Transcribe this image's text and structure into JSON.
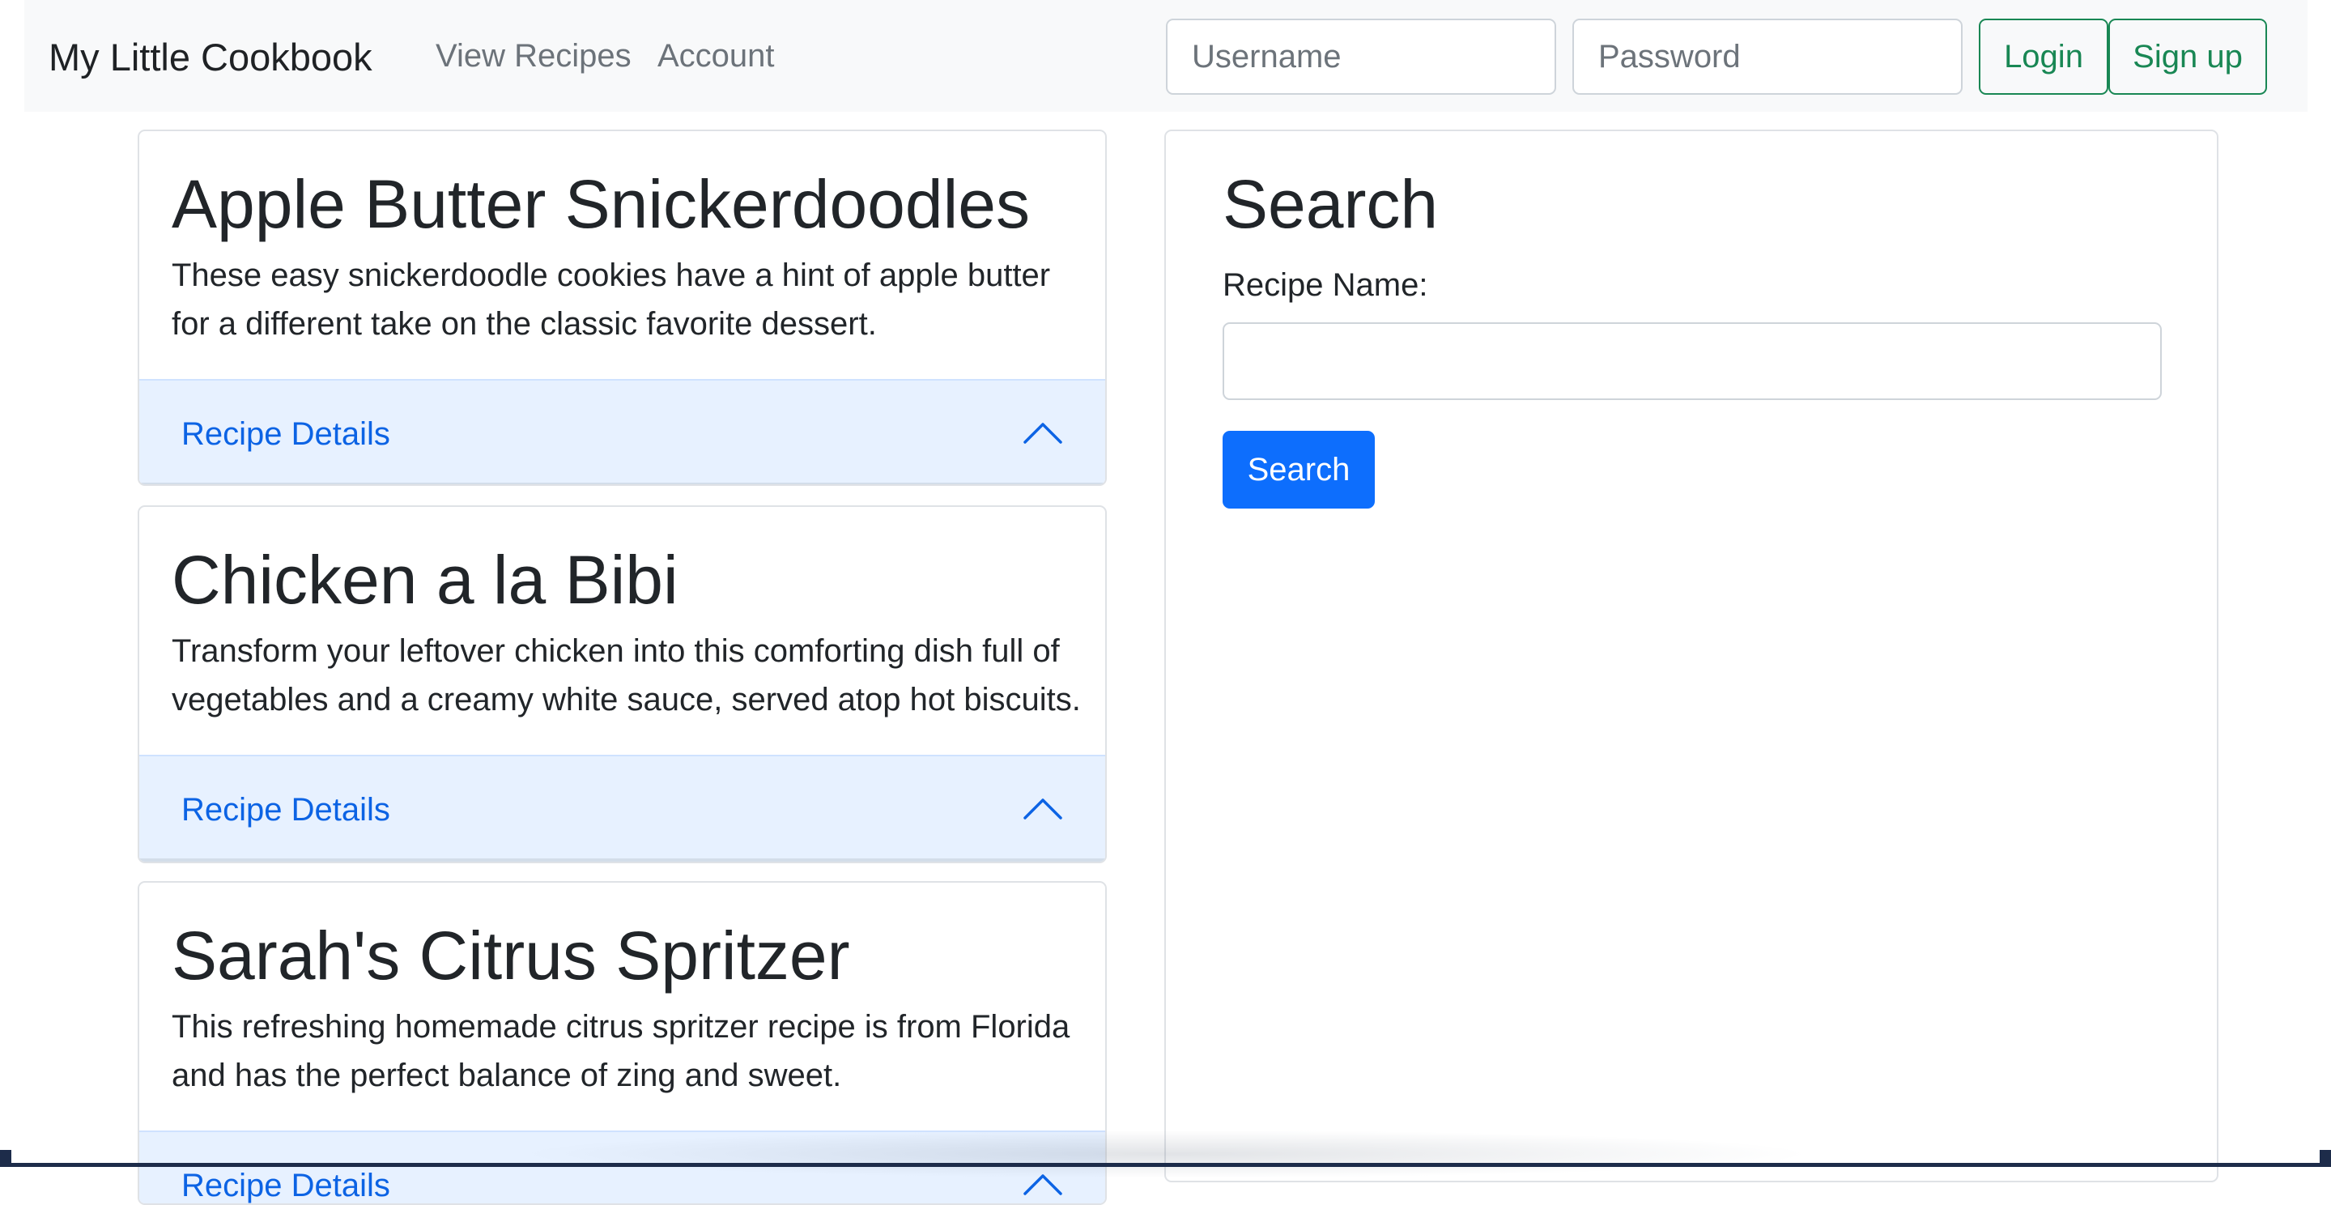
{
  "navbar": {
    "brand": "My Little Cookbook",
    "links": [
      "View Recipes",
      "Account"
    ],
    "username_placeholder": "Username",
    "password_placeholder": "Password",
    "login_label": "Login",
    "signup_label": "Sign up"
  },
  "recipes": [
    {
      "title": "Apple Butter Snickerdoodles",
      "description": "These easy snickerdoodle cookies have a hint of apple butter for a different take on the classic favorite dessert.",
      "details_label": "Recipe Details"
    },
    {
      "title": "Chicken a la Bibi",
      "description": "Transform your leftover chicken into this comforting dish full of vegetables and a creamy white sauce, served atop hot biscuits.",
      "details_label": "Recipe Details"
    },
    {
      "title": "Sarah's Citrus Spritzer",
      "description": "This refreshing homemade citrus spritzer recipe is from Florida and has the perfect balance of zing and sweet.",
      "details_label": "Recipe Details"
    }
  ],
  "search": {
    "title": "Search",
    "label": "Recipe Name:",
    "value": "",
    "button_label": "Search"
  },
  "icons": {
    "accordion_toggle": "chevron-up-icon"
  },
  "colors": {
    "navbar_bg": "#f8f9fa",
    "success": "#198754",
    "primary": "#0d6efd",
    "accordion_bg": "#e7f1ff",
    "accordion_text": "#0c63e4"
  }
}
